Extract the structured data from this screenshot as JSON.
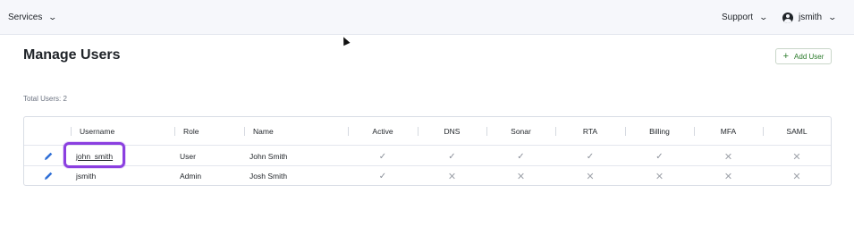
{
  "topbar": {
    "services_label": "Services",
    "support_label": "Support",
    "user_label": "jsmith"
  },
  "page": {
    "title": "Manage Users",
    "add_user_label": "Add User",
    "total_users": "Total Users: 2"
  },
  "table": {
    "columns": [
      "Username",
      "Role",
      "Name",
      "Active",
      "DNS",
      "Sonar",
      "RTA",
      "Billing",
      "MFA",
      "SAML"
    ],
    "rows": [
      {
        "username": "john_smith",
        "role": "User",
        "name": "John Smith",
        "active": "✓",
        "dns": "✓",
        "sonar": "✓",
        "rta": "✓",
        "billing": "✓",
        "mfa": "✕",
        "saml": "✕"
      },
      {
        "username": "jsmith",
        "role": "Admin",
        "name": "Josh Smith",
        "active": "✓",
        "dns": "✕",
        "sonar": "✕",
        "rta": "✕",
        "billing": "✕",
        "mfa": "✕",
        "saml": "✕"
      }
    ]
  },
  "icons": {
    "edit": "pencil-icon",
    "chevron": "chevron-down-icon",
    "avatar": "user-circle-icon",
    "add": "plus-icon"
  },
  "colors": {
    "highlight": "#8b3fe0",
    "edit_icon": "#2f6fd6",
    "add_user_text": "#2a7a2a"
  }
}
